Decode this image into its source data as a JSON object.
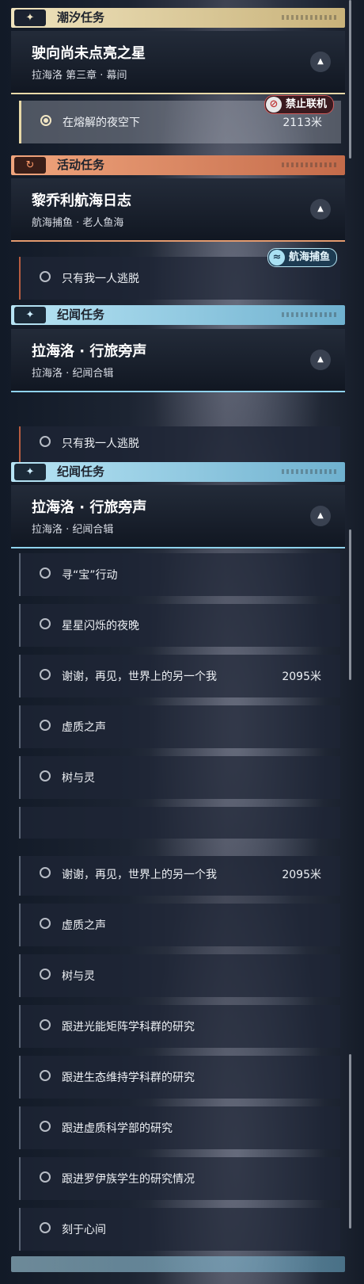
{
  "panel1": {
    "cat_tide": {
      "icon": "sparkle-icon",
      "label": "潮汐任务"
    },
    "quest_main": {
      "title": "驶向尚未点亮之星",
      "subtitle": "拉海洛 第三章 · 幕间"
    },
    "step_active": {
      "label": "在熔解的夜空下",
      "distance": "2113米",
      "badge": "禁止联机"
    },
    "cat_event": {
      "icon": "refresh-icon",
      "label": "活动任务"
    },
    "quest_event": {
      "title": "黎乔利航海日志",
      "subtitle": "航海捕鱼 · 老人鱼海"
    },
    "step_event": {
      "label": "只有我一人逃脱",
      "badge": "航海捕鱼"
    },
    "cat_story": {
      "icon": "sparkle-icon",
      "label": "纪闻任务"
    },
    "quest_story": {
      "title": "拉海洛 · 行旅旁声",
      "subtitle": "拉海洛 · 纪闻合辑"
    }
  },
  "panel2": {
    "step_event": {
      "label": "只有我一人逃脱"
    },
    "cat_story": {
      "icon": "sparkle-icon",
      "label": "纪闻任务"
    },
    "quest_story": {
      "title": "拉海洛 · 行旅旁声",
      "subtitle": "拉海洛 · 纪闻合辑"
    },
    "items": [
      {
        "label": "寻“宝”行动",
        "distance": ""
      },
      {
        "label": "星星闪烁的夜晚",
        "distance": ""
      },
      {
        "label": "谢谢，再见，世界上的另一个我",
        "distance": "2095米"
      },
      {
        "label": "虚质之声",
        "distance": ""
      },
      {
        "label": "树与灵",
        "distance": ""
      }
    ]
  },
  "panel3": {
    "items": [
      {
        "label": "谢谢，再见，世界上的另一个我",
        "distance": "2095米"
      },
      {
        "label": "虚质之声",
        "distance": ""
      },
      {
        "label": "树与灵",
        "distance": ""
      },
      {
        "label": "跟进光能矩阵学科群的研究",
        "distance": ""
      },
      {
        "label": "跟进生态维持学科群的研究",
        "distance": ""
      },
      {
        "label": "跟进虚质科学部的研究",
        "distance": ""
      },
      {
        "label": "跟进罗伊族学生的研究情况",
        "distance": ""
      },
      {
        "label": "刻于心间",
        "distance": ""
      }
    ]
  },
  "colors": {
    "tide": "#e8d9a8",
    "event": "#e39a6e",
    "story": "#8fd2ec",
    "forbid": "#d05a5a"
  }
}
